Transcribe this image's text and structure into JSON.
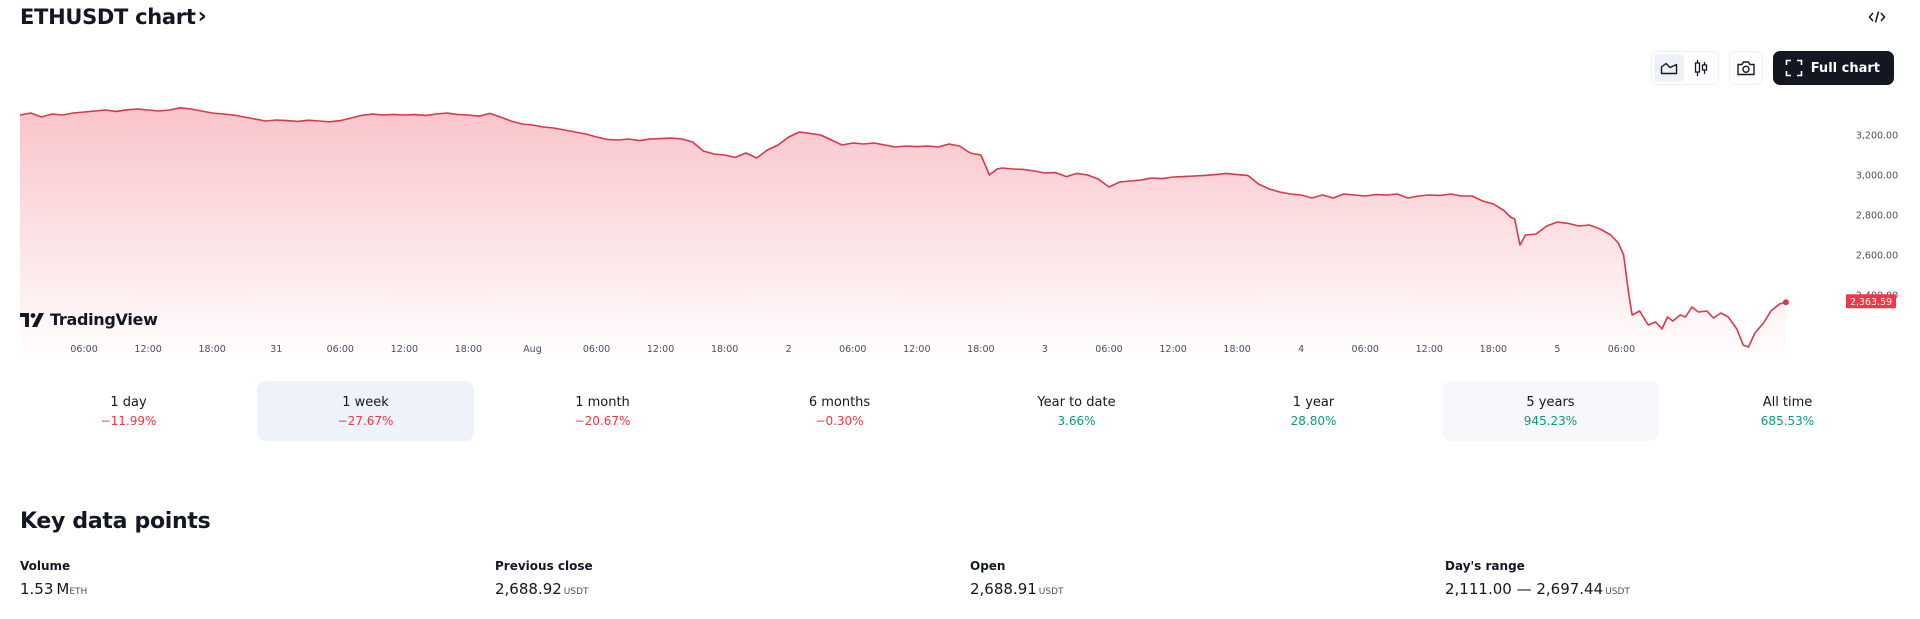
{
  "header": {
    "title": "ETHUSDT chart",
    "title_chevron": "›",
    "embed_icon": "code-embed-icon"
  },
  "toolbar": {
    "area_icon": "area-chart-icon",
    "candles_icon": "candlestick-icon",
    "snapshot_icon": "camera-icon",
    "full_chart_label": "Full chart",
    "full_chart_icon": "fullscreen-icon"
  },
  "branding": {
    "logo_text": "TradingView"
  },
  "colors": {
    "line": "#d7384b",
    "fill_top": "#f9c4ca",
    "fill_bottom": "#ffffff",
    "negative": "#f23645",
    "positive": "#089981",
    "label_bg": "#f23645",
    "dark_button": "#131722"
  },
  "chart_data": {
    "type": "area",
    "title": "ETHUSDT",
    "xlabel": "",
    "ylabel": "",
    "ylim": [
      2080,
      3360
    ],
    "grid": false,
    "y_ticks": [
      3200,
      3000,
      2800,
      2600,
      2400
    ],
    "y_tick_labels": [
      "3,200.00",
      "3,000.00",
      "2,800.00",
      "2,600.00",
      "2,400.00"
    ],
    "x_range_hours": [
      0,
      170
    ],
    "x_ticks": [
      {
        "h": 6,
        "label": "06:00"
      },
      {
        "h": 12,
        "label": "12:00"
      },
      {
        "h": 18,
        "label": "18:00"
      },
      {
        "h": 24,
        "label": "31"
      },
      {
        "h": 30,
        "label": "06:00"
      },
      {
        "h": 36,
        "label": "12:00"
      },
      {
        "h": 42,
        "label": "18:00"
      },
      {
        "h": 48,
        "label": "Aug"
      },
      {
        "h": 54,
        "label": "06:00"
      },
      {
        "h": 60,
        "label": "12:00"
      },
      {
        "h": 66,
        "label": "18:00"
      },
      {
        "h": 72,
        "label": "2"
      },
      {
        "h": 78,
        "label": "06:00"
      },
      {
        "h": 84,
        "label": "12:00"
      },
      {
        "h": 90,
        "label": "18:00"
      },
      {
        "h": 96,
        "label": "3"
      },
      {
        "h": 102,
        "label": "06:00"
      },
      {
        "h": 108,
        "label": "12:00"
      },
      {
        "h": 114,
        "label": "18:00"
      },
      {
        "h": 120,
        "label": "4"
      },
      {
        "h": 126,
        "label": "06:00"
      },
      {
        "h": 132,
        "label": "12:00"
      },
      {
        "h": 138,
        "label": "18:00"
      },
      {
        "h": 144,
        "label": "5"
      },
      {
        "h": 150,
        "label": "06:00"
      }
    ],
    "series": [
      {
        "name": "ETHUSDT",
        "points": [
          [
            0,
            3300
          ],
          [
            1,
            3310
          ],
          [
            2,
            3290
          ],
          [
            3,
            3305
          ],
          [
            4,
            3300
          ],
          [
            5,
            3310
          ],
          [
            6,
            3315
          ],
          [
            7,
            3320
          ],
          [
            8,
            3325
          ],
          [
            9,
            3318
          ],
          [
            10,
            3326
          ],
          [
            11,
            3330
          ],
          [
            12,
            3325
          ],
          [
            13,
            3320
          ],
          [
            14,
            3325
          ],
          [
            15,
            3336
          ],
          [
            16,
            3330
          ],
          [
            17,
            3320
          ],
          [
            18,
            3310
          ],
          [
            19,
            3305
          ],
          [
            20,
            3300
          ],
          [
            21,
            3290
          ],
          [
            22,
            3280
          ],
          [
            23,
            3270
          ],
          [
            24,
            3275
          ],
          [
            25,
            3272
          ],
          [
            26,
            3268
          ],
          [
            27,
            3274
          ],
          [
            28,
            3270
          ],
          [
            29,
            3266
          ],
          [
            30,
            3272
          ],
          [
            31,
            3285
          ],
          [
            32,
            3298
          ],
          [
            33,
            3305
          ],
          [
            34,
            3300
          ],
          [
            35,
            3303
          ],
          [
            36,
            3300
          ],
          [
            37,
            3302
          ],
          [
            38,
            3298
          ],
          [
            39,
            3305
          ],
          [
            40,
            3310
          ],
          [
            41,
            3302
          ],
          [
            42,
            3300
          ],
          [
            43,
            3294
          ],
          [
            44,
            3308
          ],
          [
            45,
            3290
          ],
          [
            46,
            3270
          ],
          [
            47,
            3255
          ],
          [
            48,
            3250
          ],
          [
            49,
            3240
          ],
          [
            50,
            3235
          ],
          [
            51,
            3225
          ],
          [
            52,
            3215
          ],
          [
            53,
            3205
          ],
          [
            54,
            3190
          ],
          [
            55,
            3178
          ],
          [
            56,
            3175
          ],
          [
            57,
            3180
          ],
          [
            58,
            3172
          ],
          [
            59,
            3180
          ],
          [
            60,
            3182
          ],
          [
            61,
            3185
          ],
          [
            62,
            3180
          ],
          [
            63,
            3165
          ],
          [
            64,
            3120
          ],
          [
            65,
            3105
          ],
          [
            66,
            3100
          ],
          [
            67,
            3088
          ],
          [
            68,
            3110
          ],
          [
            69,
            3085
          ],
          [
            70,
            3125
          ],
          [
            71,
            3150
          ],
          [
            72,
            3190
          ],
          [
            73,
            3215
          ],
          [
            74,
            3208
          ],
          [
            75,
            3200
          ],
          [
            76,
            3175
          ],
          [
            77,
            3150
          ],
          [
            78,
            3160
          ],
          [
            79,
            3155
          ],
          [
            80,
            3160
          ],
          [
            81,
            3150
          ],
          [
            82,
            3140
          ],
          [
            83,
            3145
          ],
          [
            84,
            3142
          ],
          [
            85,
            3145
          ],
          [
            86,
            3140
          ],
          [
            87,
            3155
          ],
          [
            88,
            3145
          ],
          [
            89,
            3110
          ],
          [
            90,
            3100
          ],
          [
            90.8,
            3000
          ],
          [
            91.5,
            3030
          ],
          [
            92,
            3035
          ],
          [
            93,
            3030
          ],
          [
            94,
            3028
          ],
          [
            95,
            3020
          ],
          [
            96,
            3010
          ],
          [
            97,
            3012
          ],
          [
            98,
            2992
          ],
          [
            99,
            3008
          ],
          [
            100,
            3000
          ],
          [
            101,
            2980
          ],
          [
            102,
            2940
          ],
          [
            103,
            2965
          ],
          [
            104,
            2970
          ],
          [
            105,
            2975
          ],
          [
            106,
            2985
          ],
          [
            107,
            2982
          ],
          [
            108,
            2990
          ],
          [
            109,
            2992
          ],
          [
            110,
            2995
          ],
          [
            111,
            2998
          ],
          [
            112,
            3002
          ],
          [
            113,
            3008
          ],
          [
            114,
            3002
          ],
          [
            115,
            2998
          ],
          [
            116,
            2955
          ],
          [
            117,
            2930
          ],
          [
            118,
            2915
          ],
          [
            119,
            2905
          ],
          [
            120,
            2900
          ],
          [
            121,
            2885
          ],
          [
            122,
            2900
          ],
          [
            123,
            2885
          ],
          [
            124,
            2905
          ],
          [
            125,
            2900
          ],
          [
            126,
            2895
          ],
          [
            127,
            2902
          ],
          [
            128,
            2900
          ],
          [
            129,
            2905
          ],
          [
            130,
            2885
          ],
          [
            131,
            2895
          ],
          [
            132,
            2900
          ],
          [
            133,
            2898
          ],
          [
            134,
            2905
          ],
          [
            135,
            2895
          ],
          [
            136,
            2895
          ],
          [
            137,
            2870
          ],
          [
            138,
            2855
          ],
          [
            139,
            2822
          ],
          [
            139.6,
            2790
          ],
          [
            140,
            2780
          ],
          [
            140.5,
            2650
          ],
          [
            141,
            2700
          ],
          [
            142,
            2705
          ],
          [
            143,
            2745
          ],
          [
            144,
            2765
          ],
          [
            145,
            2758
          ],
          [
            146,
            2745
          ],
          [
            147,
            2750
          ],
          [
            148,
            2730
          ],
          [
            149,
            2700
          ],
          [
            149.7,
            2660
          ],
          [
            150.2,
            2600
          ],
          [
            150.7,
            2400
          ],
          [
            151,
            2300
          ],
          [
            151.7,
            2320
          ],
          [
            152.5,
            2250
          ],
          [
            153.2,
            2265
          ],
          [
            153.8,
            2230
          ],
          [
            154.3,
            2290
          ],
          [
            154.8,
            2270
          ],
          [
            155.5,
            2300
          ],
          [
            156,
            2290
          ],
          [
            156.6,
            2340
          ],
          [
            157.2,
            2315
          ],
          [
            158,
            2320
          ],
          [
            158.6,
            2285
          ],
          [
            159.3,
            2310
          ],
          [
            160,
            2290
          ],
          [
            160.8,
            2230
          ],
          [
            161.4,
            2150
          ],
          [
            161.9,
            2140
          ],
          [
            162.5,
            2210
          ],
          [
            163.3,
            2260
          ],
          [
            164,
            2320
          ],
          [
            164.8,
            2355
          ],
          [
            165.4,
            2363.59
          ]
        ]
      }
    ],
    "last_price": 2363.59,
    "last_price_label": "2,363.59"
  },
  "periods": [
    {
      "label": "1 day",
      "value": "−11.99%",
      "trend": "neg",
      "state": ""
    },
    {
      "label": "1 week",
      "value": "−27.67%",
      "trend": "neg",
      "state": "active"
    },
    {
      "label": "1 month",
      "value": "−20.67%",
      "trend": "neg",
      "state": ""
    },
    {
      "label": "6 months",
      "value": "−0.30%",
      "trend": "neg",
      "state": ""
    },
    {
      "label": "Year to date",
      "value": "3.66%",
      "trend": "pos",
      "state": ""
    },
    {
      "label": "1 year",
      "value": "28.80%",
      "trend": "pos",
      "state": ""
    },
    {
      "label": "5 years",
      "value": "945.23%",
      "trend": "pos",
      "state": "hover"
    },
    {
      "label": "All time",
      "value": "685.53%",
      "trend": "pos",
      "state": ""
    }
  ],
  "key_data": {
    "title": "Key data points",
    "items": [
      {
        "label": "Volume",
        "value": "1.53",
        "unit_big": "M",
        "unit": "ETH"
      },
      {
        "label": "Previous close",
        "value": "2,688.92",
        "unit_big": "",
        "unit": "USDT"
      },
      {
        "label": "Open",
        "value": "2,688.91",
        "unit_big": "",
        "unit": "USDT"
      },
      {
        "label": "Day's range",
        "value": "2,111.00 — 2,697.44",
        "unit_big": "",
        "unit": "USDT"
      }
    ]
  }
}
